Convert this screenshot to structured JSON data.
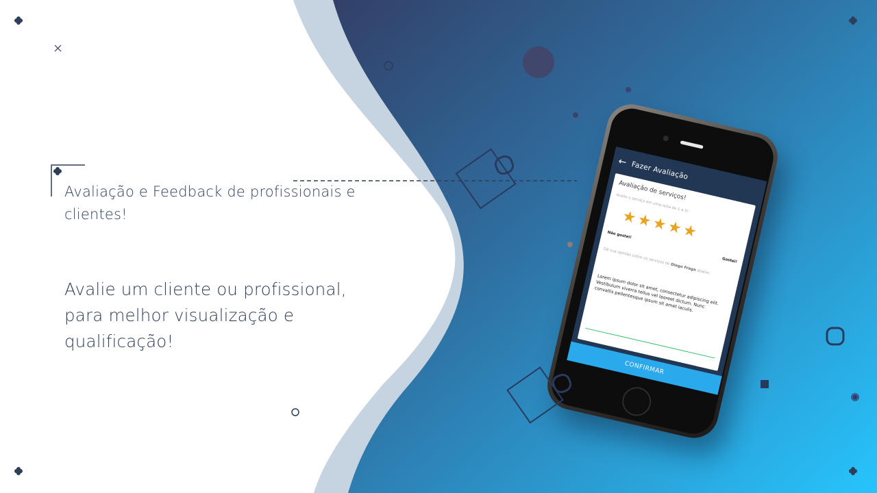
{
  "slide": {
    "headline": "Avaliação e Feedback de profissionais e clientes!",
    "subline": "Avalie um cliente ou profissional, para melhor visualização e qualificação!"
  },
  "app": {
    "appbar_title": "Fazer Avaliação",
    "card_title": "Avaliação de serviços!",
    "rating_hint": "Avalie o serviço em uma nota de 1 a 5!",
    "rating": {
      "value": 5,
      "max": 5
    },
    "rating_low_label": "Não gostei!",
    "rating_high_label": "Gostei!",
    "opinion_prefix": "Dê sua opinião sobre os serviços de",
    "opinion_name": "Diego Fraga",
    "opinion_suffix": "abaixo.",
    "comment_text": "Lorem ipsum dolor sit amet, consectetur adipiscing elit. Vestibulum viverra tellus vel laoreet dictum. Nunc convallis pellentesque ipsum sit amet iaculis.",
    "confirm_label": "CONFIRMAR"
  },
  "colors": {
    "navy_text": "#2d3e58",
    "gradient_start": "#33466e",
    "gradient_end": "#27c3fb",
    "wave_light": "#c7d3e1",
    "star": "#e9a323",
    "confirm": "#2aa9ec",
    "input_underline": "#2fbf6b"
  },
  "icons": {
    "back": "arrow-left-icon",
    "star": "star-icon",
    "plus": "plus-cross-icon"
  }
}
